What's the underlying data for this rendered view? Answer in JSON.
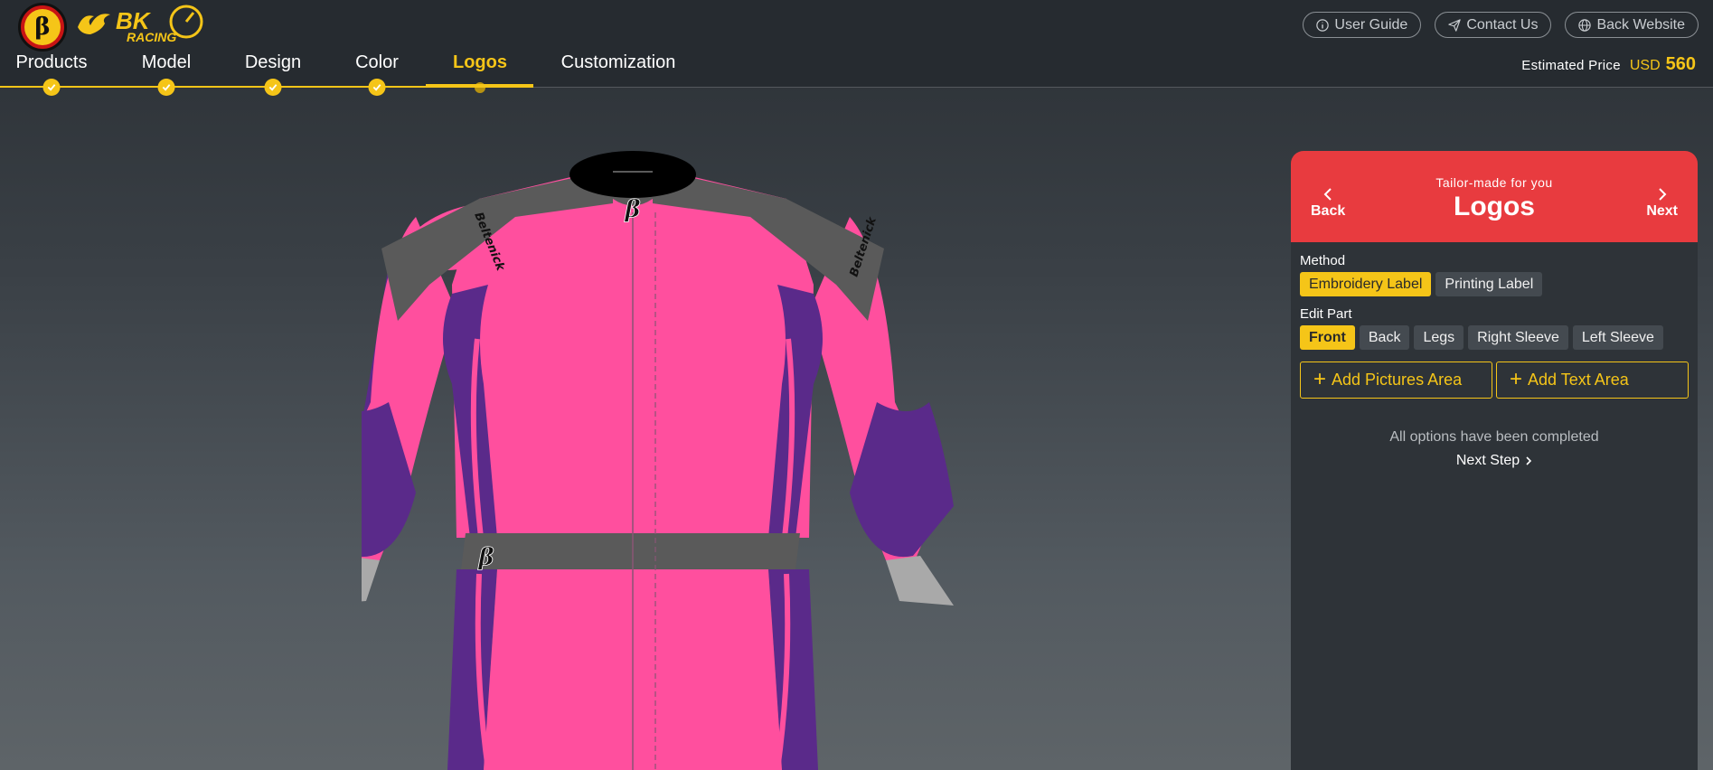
{
  "brand": {
    "badge_letter": "β",
    "name": "BK RACING"
  },
  "top_links": [
    {
      "label": "User Guide",
      "icon": "info-icon"
    },
    {
      "label": "Contact Us",
      "icon": "send-icon"
    },
    {
      "label": "Back Website",
      "icon": "globe-icon"
    }
  ],
  "steps": [
    {
      "label": "Products",
      "done": true
    },
    {
      "label": "Model",
      "done": true
    },
    {
      "label": "Design",
      "done": true
    },
    {
      "label": "Color",
      "done": true
    },
    {
      "label": "Logos",
      "done": false,
      "active": true
    },
    {
      "label": "Customization",
      "done": false
    }
  ],
  "price": {
    "label": "Estimated Price",
    "currency": "USD",
    "value": "560"
  },
  "suit": {
    "collar_logo": "β",
    "belt_logo": "β",
    "sleeve_text": "Beltenick",
    "colors": {
      "body": "#ff4f9e",
      "accent": "#5a2a8a",
      "trim": "#5a5a5a",
      "cuff": "#a9a9a9"
    }
  },
  "panel": {
    "subtitle": "Tailor-made for you",
    "title": "Logos",
    "back_label": "Back",
    "next_label": "Next",
    "method_label": "Method",
    "methods": [
      {
        "label": "Embroidery Label",
        "selected": true
      },
      {
        "label": "Printing Label",
        "selected": false
      }
    ],
    "edit_part_label": "Edit Part",
    "parts": [
      {
        "label": "Front",
        "selected": true
      },
      {
        "label": "Back",
        "selected": false
      },
      {
        "label": "Legs",
        "selected": false
      },
      {
        "label": "Right Sleeve",
        "selected": false
      },
      {
        "label": "Left Sleeve",
        "selected": false
      }
    ],
    "add_pictures": "Add Pictures Area",
    "add_text": "Add Text Area",
    "complete_text": "All options have been completed",
    "next_step": "Next Step"
  },
  "colors": {
    "accent": "#f5c518",
    "header_red": "#e83b3f",
    "panel_bg": "#2e3338"
  }
}
